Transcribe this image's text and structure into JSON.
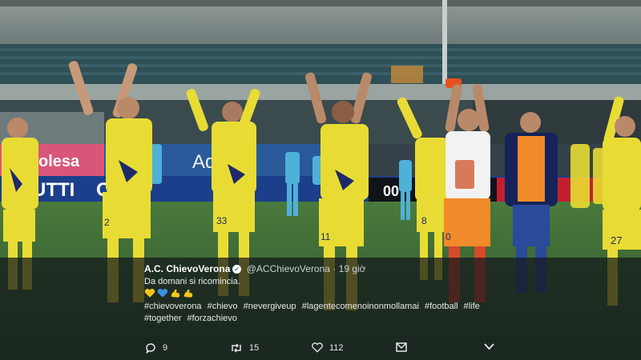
{
  "tweet": {
    "display_name": "A.C. ChievoVerona",
    "handle": "@ACChievoVerona",
    "separator": "·",
    "time": "19 giờ",
    "text": "Da domani si ricomincia.",
    "emojis": [
      "yellow-heart",
      "blue-heart",
      "flexed-biceps",
      "flexed-biceps"
    ],
    "hashtags": [
      "#chievoverona",
      "#chievo",
      "#nevergiveup",
      "#lagentecomenoinonmollamai",
      "#football",
      "#life",
      "#together",
      "#forzachievo"
    ]
  },
  "actions": {
    "reply_count": "9",
    "retweet_count": "15",
    "like_count": "112"
  },
  "photo": {
    "banner_left": "olesa",
    "banner_mid": "Aq",
    "banner_bottom": "UTTI    OSTI",
    "banner_right": "00",
    "jersey_numbers": [
      "2",
      "33",
      "11",
      "8",
      "0",
      "27"
    ]
  },
  "colors": {
    "kit_yellow": "#e8dc34",
    "kit_navy": "#1e2a6a",
    "pitch_green": "#3c6a33",
    "overlay": "#14181c"
  }
}
